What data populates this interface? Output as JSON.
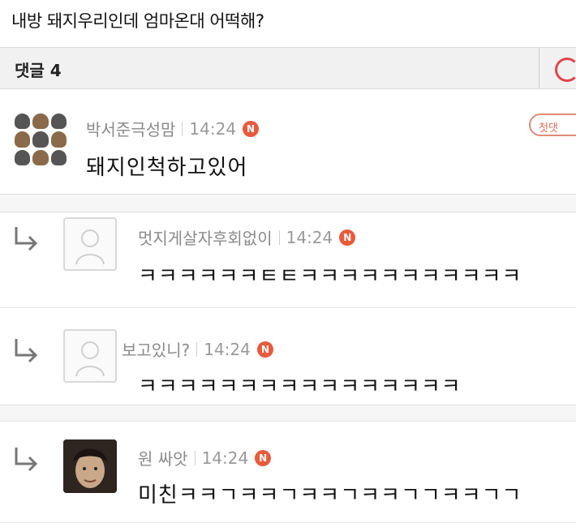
{
  "post": {
    "title": "내방 돼지우리인데 엄마온대 어떡해?"
  },
  "comments_bar": {
    "label": "댓글 4"
  },
  "comments": [
    {
      "author": "박서준극성맘",
      "time": "14:24",
      "badge": "N",
      "text": "돼지인척하고있어",
      "tag": "첫댓"
    },
    {
      "author": "멋지게살자후회없이",
      "time": "14:24",
      "badge": "N",
      "text": "ㅋㅋㅋㅋㅋㅋㅌㅌㅋㅋㅋㅋㅋㅋㅋㅋㅋㅋㅋ"
    },
    {
      "author": "보고있니?",
      "time": "14:24",
      "badge": "N",
      "text": "ㅋㅋㅋㅋㅋㅋㅋㅋㅋㅋㅋㅋㅋㅋㅋㅋ"
    },
    {
      "author": "원 싸앗",
      "time": "14:24",
      "badge": "N",
      "text": "미친ㅋㅋㄱㅋㅋㄱㅋㅋㄱㅋㅋㄱㄱㅋㅋㄱㄱ"
    }
  ],
  "icons": {
    "refresh": "refresh-icon",
    "reply": "reply-arrow-icon",
    "new": "new-badge-icon",
    "default_avatar": "default-avatar-icon"
  },
  "colors": {
    "accent": "#e85a3c",
    "bar_bg": "#f1f1f1"
  }
}
